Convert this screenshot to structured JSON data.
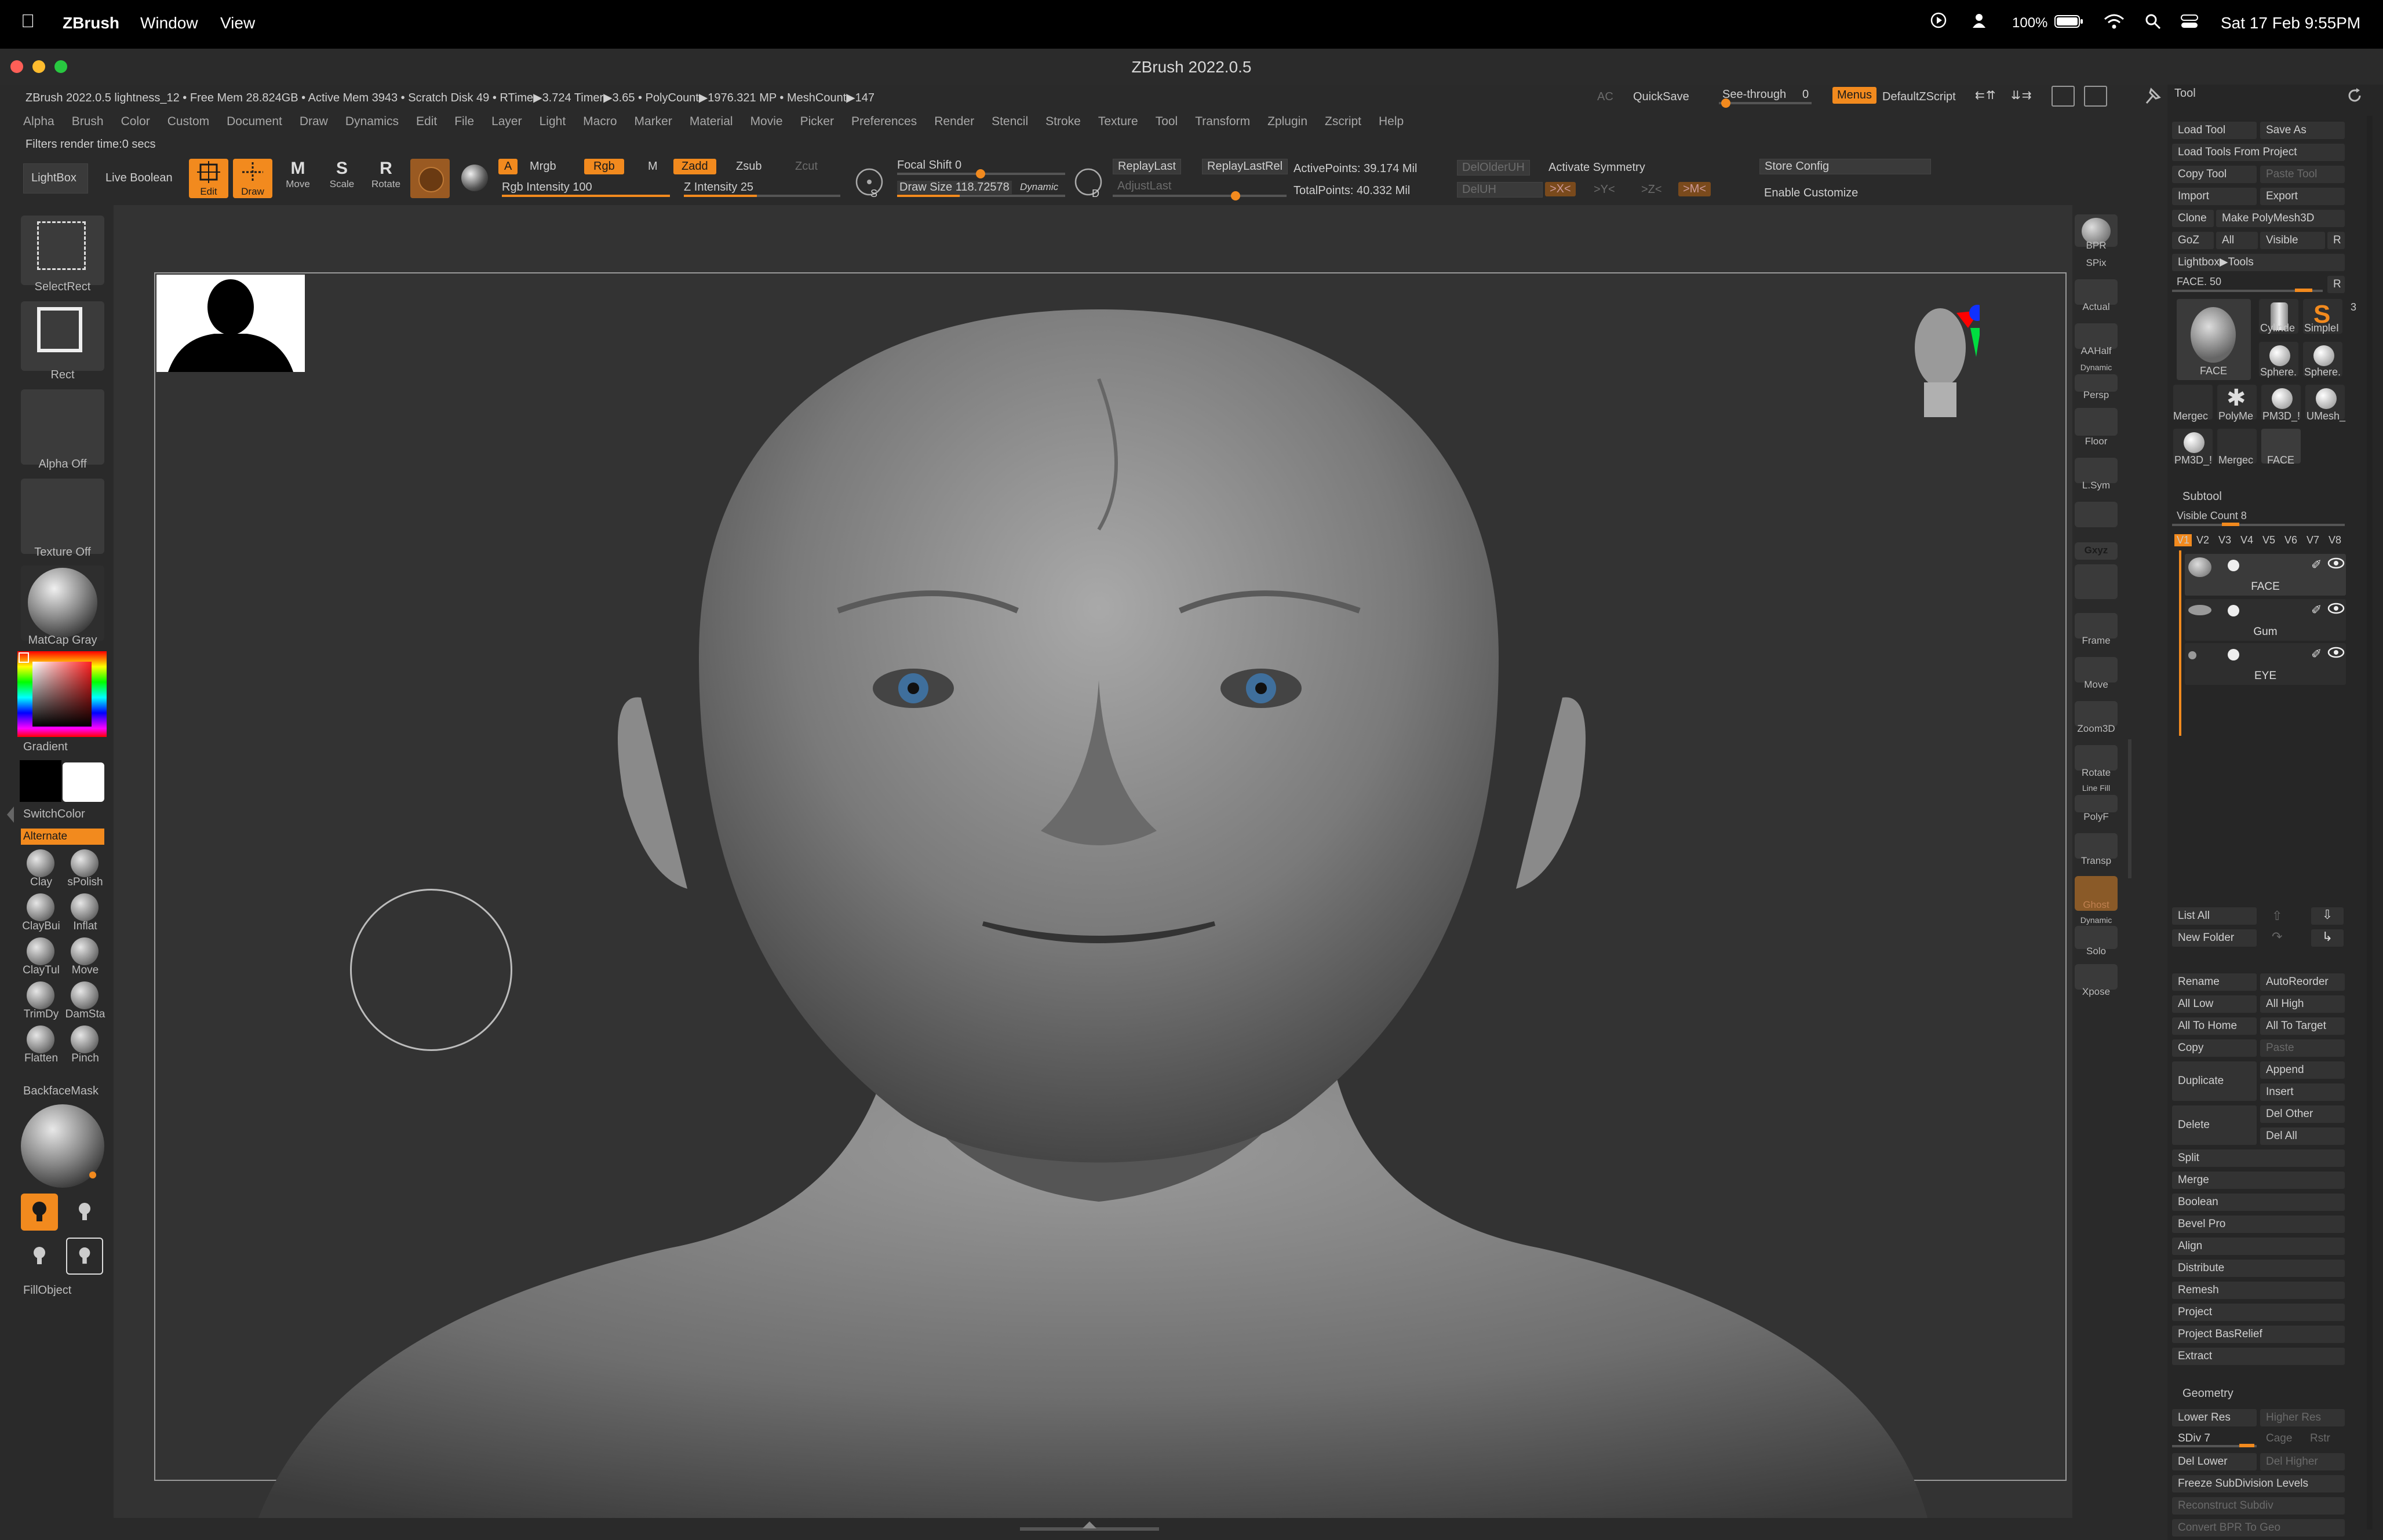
{
  "macos_menubar": {
    "app_name": "ZBrush",
    "menus": [
      "Window",
      "View"
    ],
    "battery": "100%",
    "datetime": "Sat 17 Feb  9:55PM"
  },
  "window": {
    "title": "ZBrush 2022.0.5"
  },
  "status_bar": {
    "info": "ZBrush 2022.0.5 lightness_12   • Free Mem 28.824GB • Active Mem 3943 • Scratch Disk 49 • RTime▶3.724 Timer▶3.65 • PolyCount▶1976.321 MP • MeshCount▶147",
    "ac": "AC",
    "quicksave": "QuickSave",
    "see_through": "See-through",
    "see_through_value": "0",
    "menus_toggle": "Menus",
    "default_zscript": "DefaultZScript"
  },
  "main_menu": [
    "Alpha",
    "Brush",
    "Color",
    "Custom",
    "Document",
    "Draw",
    "Dynamics",
    "Edit",
    "File",
    "Layer",
    "Light",
    "Macro",
    "Marker",
    "Material",
    "Movie",
    "Picker",
    "Preferences",
    "Render",
    "Stencil",
    "Stroke",
    "Texture",
    "Tool",
    "Transform",
    "Zplugin",
    "Zscript",
    "Help"
  ],
  "filter_status": "Filters render time:0 secs",
  "toolbar": {
    "lightbox": "LightBox",
    "live_boolean": "Live Boolean",
    "edit": "Edit",
    "draw": "Draw",
    "move": "Move",
    "scale": "Scale",
    "rotate": "Rotate",
    "a_label": "A",
    "mrgb": "Mrgb",
    "rgb": "Rgb",
    "m": "M",
    "zadd": "Zadd",
    "zsub": "Zsub",
    "zcut": "Zcut",
    "rgb_intensity": "Rgb Intensity 100",
    "z_intensity": "Z Intensity 25",
    "focal_shift": "Focal Shift 0",
    "draw_size": "Draw Size 118.72578",
    "dynamic": "Dynamic",
    "replay_last": "ReplayLast",
    "replay_last_rel": "ReplayLastRel",
    "adjust_last": "AdjustLast",
    "active_points": "ActivePoints: 39.174 Mil",
    "total_points": "TotalPoints: 40.332 Mil",
    "del_older_uh": "DelOlderUH",
    "del_uh": "DelUH",
    "activate_symmetry": "Activate Symmetry",
    "sym_x": ">X<",
    "sym_y": ">Y<",
    "sym_z": ">Z<",
    "sym_m": ">M<",
    "store_config": "Store Config",
    "enable_customize": "Enable Customize"
  },
  "left_shelf": {
    "select_rect": "SelectRect",
    "rect": "Rect",
    "alpha_off": "Alpha Off",
    "texture_off": "Texture Off",
    "matcap": "MatCap Gray",
    "gradient": "Gradient",
    "switch_color": "SwitchColor",
    "alternate": "Alternate",
    "brushes": [
      "Clay",
      "sPolish",
      "ClayBui",
      "Inflat",
      "ClayTul",
      "Move",
      "TrimDy",
      "DamSta",
      "Flatten",
      "Pinch"
    ],
    "backface_mask": "BackfaceMask",
    "fill_object": "FillObject"
  },
  "right_shelf": [
    "BPR",
    "SPix",
    "Actual",
    "AAHalf",
    "Dynamic",
    "Persp",
    "Floor",
    "L.Sym",
    "Gxyz",
    "Frame",
    "Move",
    "Zoom3D",
    "Rotate",
    "Line Fill",
    "PolyF",
    "Transp",
    "Ghost",
    "Dynamic",
    "Solo",
    "Xpose"
  ],
  "tool_palette": {
    "title": "Tool",
    "load_tool": "Load Tool",
    "save_as": "Save As",
    "load_tools_from_project": "Load Tools From Project",
    "copy_tool": "Copy Tool",
    "paste_tool": "Paste Tool",
    "import": "Import",
    "export": "Export",
    "clone": "Clone",
    "make_polymesh3d": "Make PolyMesh3D",
    "goz": "GoZ",
    "all": "All",
    "visible": "Visible",
    "r": "R",
    "lightbox_tools": "Lightbox▶Tools",
    "face_slider": "FACE. 50",
    "face_count": "3",
    "tools": [
      {
        "label": "FACE"
      },
      {
        "label": "Cylinde"
      },
      {
        "label": "SimpleI"
      },
      {
        "label": "Sphere."
      },
      {
        "label": "Sphere."
      },
      {
        "label": "Mergec"
      },
      {
        "label": "PolyMe"
      },
      {
        "label": "PM3D_!"
      },
      {
        "label": "UMesh_"
      },
      {
        "label": "PM3D_!"
      },
      {
        "label": "Mergec"
      },
      {
        "label": "FACE"
      }
    ],
    "subtool": "Subtool",
    "visible_count": "Visible Count 8",
    "versions": [
      "V1",
      "V2",
      "V3",
      "V4",
      "V5",
      "V6",
      "V7",
      "V8"
    ],
    "subtools": [
      "FACE",
      "Gum",
      "EYE"
    ],
    "list_all": "List All",
    "new_folder": "New Folder",
    "rename": "Rename",
    "auto_reorder": "AutoReorder",
    "all_low": "All Low",
    "all_high": "All High",
    "all_to_home": "All To Home",
    "all_to_target": "All To Target",
    "copy": "Copy",
    "paste": "Paste",
    "duplicate": "Duplicate",
    "append": "Append",
    "insert": "Insert",
    "delete": "Delete",
    "del_other": "Del Other",
    "del_all": "Del All",
    "actions": [
      "Split",
      "Merge",
      "Boolean",
      "Bevel Pro",
      "Align",
      "Distribute",
      "Remesh",
      "Project",
      "Project BasRelief",
      "Extract"
    ],
    "geometry": "Geometry",
    "lower_res": "Lower Res",
    "higher_res": "Higher Res",
    "sdiv": "SDiv 7",
    "cage": "Cage",
    "rstr": "Rstr",
    "del_lower": "Del Lower",
    "del_higher": "Del Higher",
    "freeze_subdiv": "Freeze SubDivision Levels",
    "reconstruct_subdiv": "Reconstruct Subdiv",
    "convert_bpr": "Convert BPR To Geo"
  }
}
